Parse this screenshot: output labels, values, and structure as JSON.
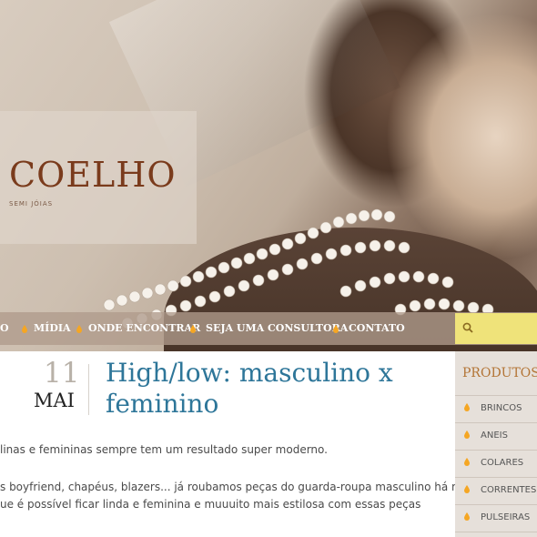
{
  "brand": {
    "name": "COELHO",
    "tagline": "SEMI JÓIAS"
  },
  "nav": {
    "items": [
      {
        "label": "O"
      },
      {
        "label": "MÍDIA"
      },
      {
        "label": "ONDE ENCONTRAR"
      },
      {
        "label": "SEJA UMA CONSULTORA"
      },
      {
        "label": "CONTATO"
      }
    ],
    "search_placeholder": ""
  },
  "post": {
    "day": "11",
    "month": "MAI",
    "title_line1": "High/low: masculino x",
    "title_line2": "feminino",
    "paragraphs": [
      "linas e femininas sempre tem um resultado super moderno.",
      "s boyfriend, chapéus, blazers... já roubamos peças do guarda-roupa masculino há muito",
      "ue é possível ficar linda e feminina e muuuito mais estilosa com essas peças"
    ]
  },
  "sidebar": {
    "heading": "PRODUTOS",
    "items": [
      {
        "label": "BRINCOS"
      },
      {
        "label": "ANEIS"
      },
      {
        "label": "COLARES"
      },
      {
        "label": "CORRENTES"
      },
      {
        "label": "PULSEIRAS"
      }
    ]
  },
  "colors": {
    "accent": "#2e7699",
    "brand": "#7a3b1c",
    "search": "#efe37a",
    "sidebar_heading": "#b37435",
    "drop_icon": "#f5a623"
  }
}
